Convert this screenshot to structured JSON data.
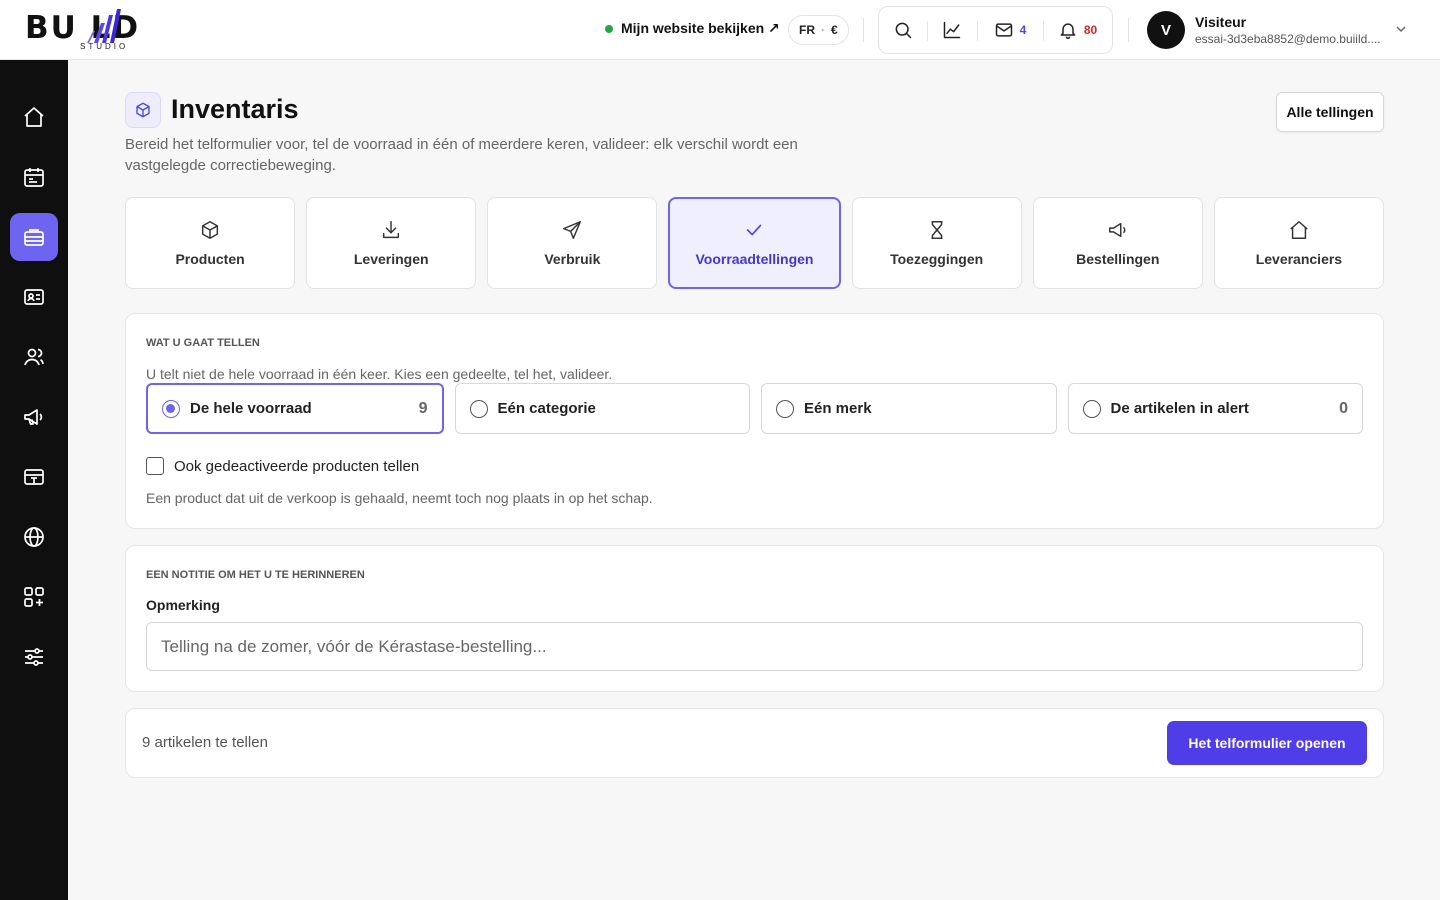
{
  "brand": {
    "logo_text": "BU  LD",
    "logo_sub": "STUDIO"
  },
  "header": {
    "site_link": "Mijn website bekijken ↗",
    "lang": "FR",
    "currency": "€",
    "mail_count": "4",
    "bell_count": "80",
    "user": {
      "initial": "V",
      "name": "Visiteur",
      "email": "essai-3d3eba8852@demo.buiild...."
    }
  },
  "sidebar": {
    "items": [
      {
        "icon": "home-icon"
      },
      {
        "icon": "calendar-icon"
      },
      {
        "icon": "inventory-icon",
        "active": true
      },
      {
        "icon": "contact-card-icon"
      },
      {
        "icon": "users-icon"
      },
      {
        "icon": "megaphone-icon"
      },
      {
        "icon": "payment-icon"
      },
      {
        "icon": "globe-icon"
      },
      {
        "icon": "apps-icon"
      },
      {
        "icon": "settings-sliders-icon"
      }
    ]
  },
  "page": {
    "title": "Inventaris",
    "description": "Bereid het telformulier voor, tel de voorraad in één of meerdere keren, valideer: elk verschil wordt een vastgelegde correctiebeweging.",
    "all_counts_button": "Alle tellingen"
  },
  "tabs": [
    {
      "label": "Producten",
      "icon": "box-icon"
    },
    {
      "label": "Leveringen",
      "icon": "download-icon"
    },
    {
      "label": "Verbruik",
      "icon": "send-icon"
    },
    {
      "label": "Voorraadtellingen",
      "icon": "check-icon",
      "active": true
    },
    {
      "label": "Toezeggingen",
      "icon": "hourglass-icon"
    },
    {
      "label": "Bestellingen",
      "icon": "megaphone-icon"
    },
    {
      "label": "Leveranciers",
      "icon": "house-icon"
    }
  ],
  "scope": {
    "section_title": "WAT U GAAT TELLEN",
    "help": "U telt niet de hele voorraad in één keer. Kies een gedeelte, tel het, valideer.",
    "options": [
      {
        "label": "De hele voorraad",
        "count": "9",
        "selected": true
      },
      {
        "label": "Eén categorie",
        "count": ""
      },
      {
        "label": "Eén merk",
        "count": ""
      },
      {
        "label": "De artikelen in alert",
        "count": "0"
      }
    ],
    "checkbox_label": "Ook gedeactiveerde producten tellen",
    "checkbox_checked": false,
    "checkbox_help": "Een product dat uit de verkoop is gehaald, neemt toch nog plaats in op het schap."
  },
  "note": {
    "section_title": "EEN NOTITIE OM HET U TE HERINNEREN",
    "label": "Opmerking",
    "placeholder": "Telling na de zomer, vóór de Kérastase-bestelling...",
    "value": ""
  },
  "footer": {
    "summary": "9 artikelen te tellen",
    "open_button": "Het telformulier openen"
  },
  "colors": {
    "accent": "#6d64f0",
    "button": "#4f3de8",
    "sidebar": "#0f0f10"
  }
}
